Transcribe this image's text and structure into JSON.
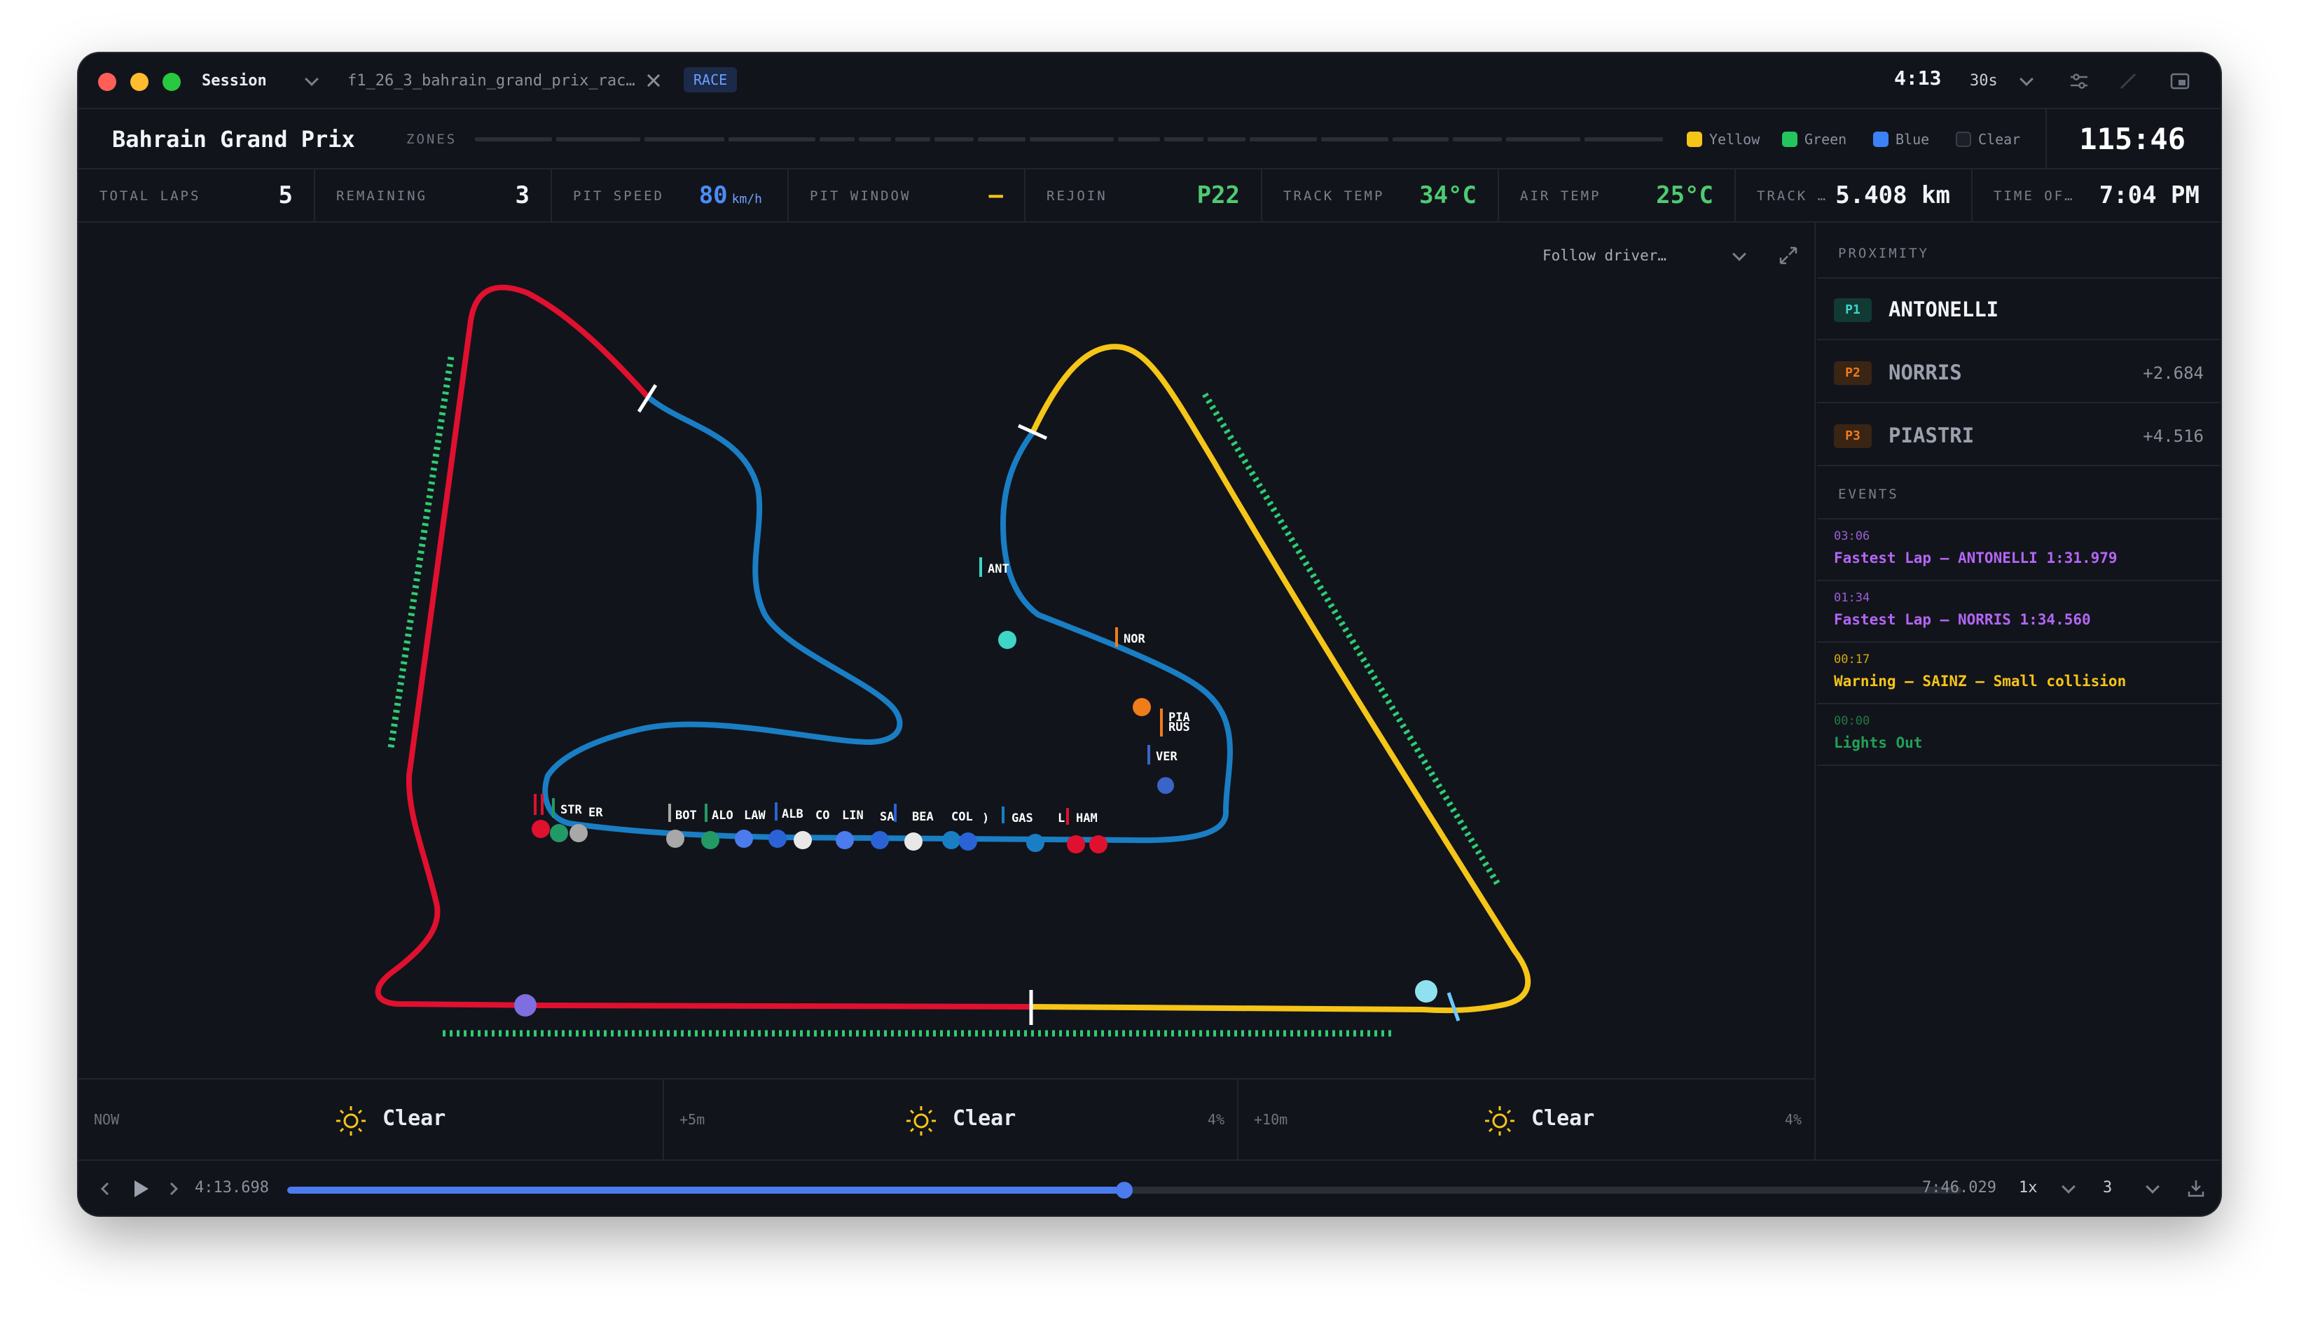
{
  "titlebar": {
    "session_label": "Session",
    "file_tab": "f1_26_3_bahrain_grand_prix_rac…",
    "race_badge": "RACE",
    "clock": "4:13",
    "interval": "30s"
  },
  "header": {
    "title": "Bahrain Grand Prix",
    "zones_label": "ZONES",
    "legend": [
      {
        "label": "Yellow",
        "color": "#f5c518"
      },
      {
        "label": "Green",
        "color": "#22c55e"
      },
      {
        "label": "Blue",
        "color": "#3b82f6"
      },
      {
        "label": "Clear",
        "color": "#2a2e37"
      }
    ],
    "race_timer": "115:46"
  },
  "stats": {
    "total_laps": {
      "label": "TOTAL LAPS",
      "value": "5"
    },
    "remaining": {
      "label": "REMAINING",
      "value": "3"
    },
    "pit_speed": {
      "label": "PIT SPEED",
      "value": "80",
      "unit": "km/h"
    },
    "pit_window": {
      "label": "PIT WINDOW",
      "value": "—"
    },
    "rejoin": {
      "label": "REJOIN",
      "value": "P22"
    },
    "track_temp": {
      "label": "TRACK TEMP",
      "value": "34°C"
    },
    "air_temp": {
      "label": "AIR TEMP",
      "value": "25°C"
    },
    "track_length": {
      "label": "TRACK …",
      "value": "5.408 km"
    },
    "time_of_day": {
      "label": "TIME OF…",
      "value": "7:04 PM"
    }
  },
  "map": {
    "follow_placeholder": "Follow driver…",
    "driver_labels": [
      "ANT",
      "NOR",
      "PIA",
      "RUS",
      "VER",
      "STR",
      "ER",
      "BOT",
      "ALO",
      "LAW",
      "ALB",
      "CO",
      "LIN",
      "SA",
      "BEA",
      "COL",
      ")",
      "GAS",
      "L",
      "HAM"
    ]
  },
  "proximity": {
    "title": "PROXIMITY",
    "rows": [
      {
        "pos": "P1",
        "name": "ANTONELLI",
        "gap": ""
      },
      {
        "pos": "P2",
        "name": "NORRIS",
        "gap": "+2.684"
      },
      {
        "pos": "P3",
        "name": "PIASTRI",
        "gap": "+4.516"
      }
    ]
  },
  "events": {
    "title": "EVENTS",
    "items": [
      {
        "time": "03:06",
        "text": "Fastest Lap – ANTONELLI 1:31.979",
        "color": "#b366f5"
      },
      {
        "time": "01:34",
        "text": "Fastest Lap – NORRIS 1:34.560",
        "color": "#b366f5"
      },
      {
        "time": "00:17",
        "text": "Warning – SAINZ – Small collision",
        "color": "#f5c518"
      },
      {
        "time": "00:00",
        "text": "Lights Out",
        "color": "#22a055"
      }
    ]
  },
  "weather": [
    {
      "when": "NOW",
      "condition": "Clear",
      "pct": ""
    },
    {
      "when": "+5m",
      "condition": "Clear",
      "pct": "4%"
    },
    {
      "when": "+10m",
      "condition": "Clear",
      "pct": "4%"
    }
  ],
  "playback": {
    "current": "4:13.698",
    "total": "7:46.029",
    "progress": 0.5,
    "speed": "1x",
    "lap": "3"
  }
}
